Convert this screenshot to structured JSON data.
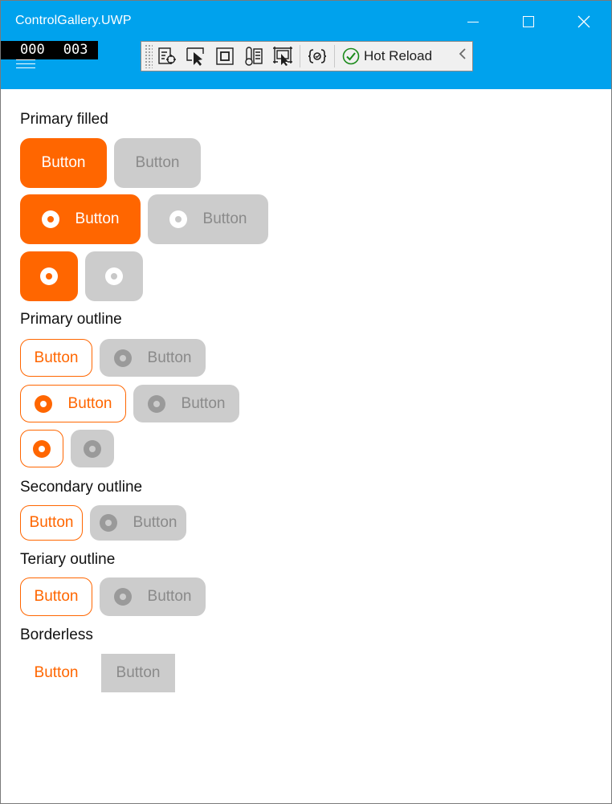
{
  "window": {
    "title": "ControlGallery.UWP",
    "frame_counter": [
      "000",
      "003"
    ]
  },
  "debug_toolbar": {
    "hot_reload_label": "Hot Reload",
    "icons": [
      "live-visual-tree-icon",
      "select-element-icon",
      "display-adorners-icon",
      "track-focus-icon",
      "layout-adorner-icon",
      "xaml-binding-failures-icon",
      "hot-reload-check-icon",
      "collapse-chevron-icon"
    ]
  },
  "sections": {
    "primary_filled": "Primary filled",
    "primary_outline": "Primary outline",
    "secondary_outline": "Secondary outline",
    "teriary_outline": "Teriary outline",
    "borderless": "Borderless"
  },
  "button_label": "Button",
  "colors": {
    "titlebar": "#00a2ed",
    "accent": "#ff6600",
    "disabled_bg": "#cccccc",
    "disabled_text": "#8a8a8a"
  }
}
